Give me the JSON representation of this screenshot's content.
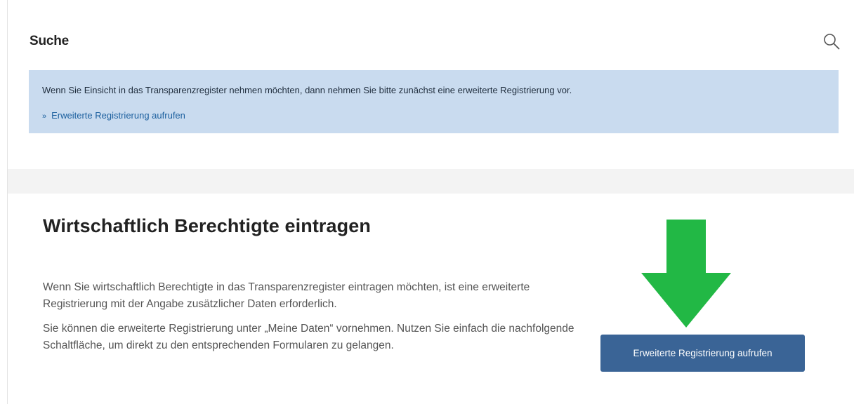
{
  "search": {
    "title": "Suche",
    "icon": "search-icon",
    "info_text": "Wenn Sie Einsicht in das Transparenzregister nehmen möchten, dann nehmen Sie bitte zunächst eine erweiterte Registrierung vor.",
    "link_chevron": "»",
    "link_label": "Erweiterte Registrierung aufrufen",
    "info_bg_color": "#c9dbef",
    "link_color": "#1b5f9e"
  },
  "register": {
    "title": "Wirtschaftlich Berechtigte eintragen",
    "paragraph1": "Wenn Sie wirtschaftlich Berechtigte in das Transparenzregister eintragen möchten, ist eine erweiterte Registrierung mit der Angabe zusätzlicher Daten erforderlich.",
    "paragraph2": "Sie können die erweiterte Registrierung unter „Meine Daten“ vornehmen. Nutzen Sie einfach die nachfolgende Schaltfläche, um direkt zu den entsprechenden Formularen zu gelangen.",
    "button_label": "Erweiterte Registrierung aufrufen",
    "button_color": "#3a6496",
    "arrow_icon": "arrow-down-icon",
    "arrow_color": "#22b845"
  }
}
